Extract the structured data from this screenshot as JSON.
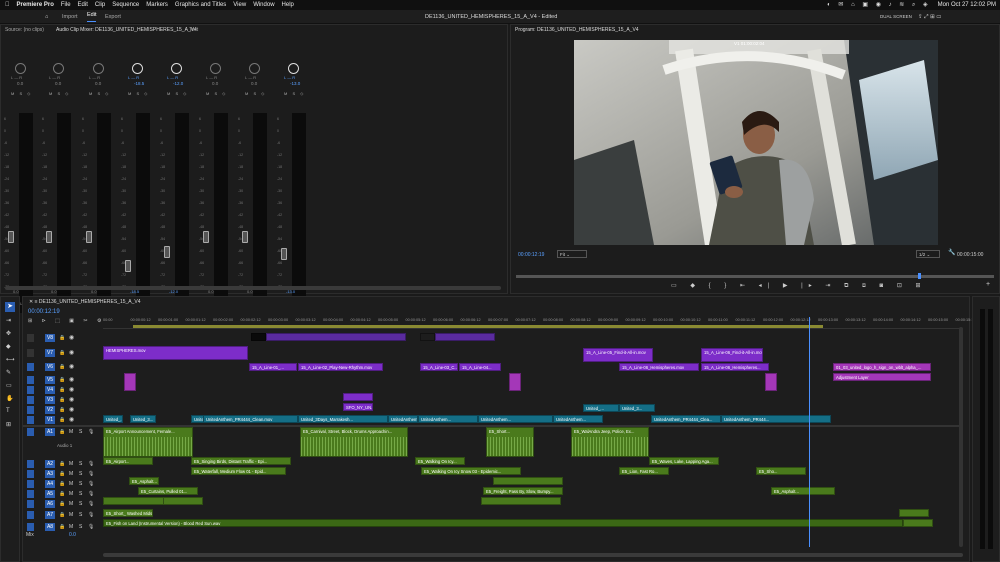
{
  "menubar": {
    "app": "Premiere Pro",
    "items": [
      "File",
      "Edit",
      "Clip",
      "Sequence",
      "Markers",
      "Graphics and Titles",
      "View",
      "Window",
      "Help"
    ],
    "clock": "Mon Oct 27  12:02 PM"
  },
  "appbar": {
    "tabs": [
      "Import",
      "Edit",
      "Export"
    ],
    "title": "DE1136_UNITED_HEMISPHERES_15_A_V4 - Edited",
    "dual": "DUAL SCREEN"
  },
  "source": {
    "tabs": [
      "Source: (no clips)",
      "Audio Clip Mixer: DE1136_UNITED_HEMISPHERES_15_A_V4",
      "Text"
    ],
    "channels": [
      {
        "id": "A1",
        "name": "Audio 1",
        "level": "0.0",
        "fader": 0.0
      },
      {
        "id": "A2",
        "name": "Audio 2",
        "level": "0.0",
        "fader": 0.0
      },
      {
        "id": "A3",
        "name": "Audio 3",
        "level": "0.0",
        "fader": 0.0
      },
      {
        "id": "A4",
        "name": "Audio 4",
        "level": "-18.5",
        "fader": -18.5,
        "active": true
      },
      {
        "id": "A5",
        "name": "Audio 5",
        "level": "-12.0",
        "fader": -12.0,
        "active": true
      },
      {
        "id": "A6",
        "name": "Audio 6",
        "level": "0.0",
        "fader": 0.0
      },
      {
        "id": "A7",
        "name": "Audio 7",
        "level": "0.0",
        "fader": 0.0
      },
      {
        "id": "A8",
        "name": "Audio 8",
        "level": "-13.0",
        "fader": -13.0,
        "active": true
      }
    ]
  },
  "program": {
    "tab": "Program: DE1136_UNITED_HEMISPHERES_15_A_V4",
    "overlay_tc": "V1 01:00:02:04",
    "timecode": "00:00:12:19",
    "fit": "Fit",
    "ratio": "1/2",
    "duration": "00:00:15:00"
  },
  "timeline": {
    "tab": "DE1136_UNITED_HEMISPHERES_15_A_V4",
    "timecode": "00:00:12:19",
    "ruler": [
      "00:00",
      "00:00:00:12",
      "00:00:01:00",
      "00:00:01:12",
      "00:00:02:00",
      "00:00:02:12",
      "00:00:03:00",
      "00:00:03:12",
      "00:00:04:00",
      "00:00:04:12",
      "00:00:05:00",
      "00:00:05:12",
      "00:00:06:00",
      "00:00:06:12",
      "00:00:07:00",
      "00:00:07:12",
      "00:00:08:00",
      "00:00:08:12",
      "00:00:09:00",
      "00:00:09:12",
      "00:00:10:00",
      "00:00:10:12",
      "00:00:11:00",
      "00:00:11:12",
      "00:00:12:00",
      "00:00:12:12",
      "00:00:13:00",
      "00:00:13:12",
      "00:00:14:00",
      "00:00:14:12",
      "00:00:15:00",
      "00:00:15:12"
    ],
    "vtracks": [
      "V8",
      "V7",
      "V6",
      "V5",
      "V4",
      "V3",
      "V2",
      "V1"
    ],
    "atracks": [
      "A1",
      "A2",
      "A3",
      "A4",
      "A5",
      "A6",
      "A7",
      "A8"
    ],
    "a1name": "Audio 1",
    "mix": "Mix",
    "mixval": "0.0",
    "clips": {
      "hemis": "HEMISPHERES.mov",
      "l1": "15_A_Line-01_...",
      "l2": "15_A_Line-02_Play-New-Rhythm.mov",
      "l3": "15_A_Line-03_C...",
      "l4": "15_A_Line-04...",
      "l5": "15_A_Line-05_Find-it-All-in.mov",
      "l6": "15_A_Line-06_Find-it-All-in.mov",
      "l7": "15_A_Line-06_Hemispheres.mov",
      "l8": "15_A_Line-06_Hemispheres...",
      "logo": "01_03_united_logo_h_sign_on_wblt_alpha_...",
      "adj": "Adjustment Layer",
      "sfo": "SFO_NY_UN...",
      "u1": "United_...",
      "u2": "United_3...",
      "u3": "UnitedAnthem_PR444...",
      "u4": "UnitedAnthem_PR4444_Clean.mov",
      "u5": "United_3Days_Marrakesh...",
      "u6": "UnitedAnthem...",
      "u7": "UnitedAnthem_PR4444_Clea...",
      "u8": "UnitedAnthem_PR444...",
      "gr1": "United_...",
      "gr2": "United_3...",
      "a_air": "E5_Airport Announcement, Female...",
      "a_carn": "E5_Carnival, Street, Block, Drums Approachin...",
      "a_short": "E5_Short...",
      "a_walk": "E5_WalAndra Jeep, Police, Ex...",
      "a2_air": "E5_Airport...",
      "a2_sing": "E5_Singing Birds, Distant Traffic - Epi...",
      "a2_walk": "E5_Walking On Icy...",
      "a2_waves": "E5_Waves, Lake, Lapping Aga...",
      "a3_water": "E5_Waterfall, Medium Flow 01 - Epid...",
      "a3_walk": "E5_Walking On Icy Snow 03 - Epidemic...",
      "a3_lion": "E5_Lion, Fast Ro...",
      "a3_sho": "E5_Sho...",
      "a4_asph": "E5_Asphalt...",
      "a4_asph2": "E5_Asphalt...",
      "a5_curt": "E5_Curtains, Pulled 01...",
      "a5_freight": "E5_Freight, Pass By, Slow, Bumpy...",
      "a6_short": "E5_Short_ Washed Mids...",
      "a7_fish": "E5_Fish on Land (Instrumental Version) - Blood Red Sun.wav"
    }
  }
}
